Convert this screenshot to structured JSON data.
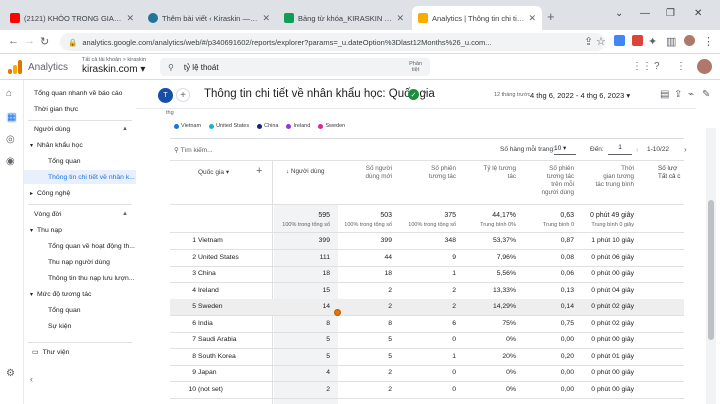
{
  "browser": {
    "tabs": [
      {
        "label": "(2121) KHÓO TRONG GIAO TIẾP...",
        "favicon_color": "#ff0000"
      },
      {
        "label": "Thêm bài viết ‹ Kiraskin — WordP...",
        "favicon_color": "#21759b"
      },
      {
        "label": "Bảng từ khóa_KIRASKIN - Google...",
        "favicon_color": "#0f9d58"
      },
      {
        "label": "Analytics | Thông tin chi tiết về n...",
        "favicon_color": "#f9ab00"
      }
    ],
    "new_tab": "+",
    "url": "analytics.google.com/analytics/web/#/p340691602/reports/explorer?params=_u.dateOption%3Dlast12Months%26_u.com..."
  },
  "ga_header": {
    "product": "Analytics",
    "account_path": "Tất cả tài khoản > kiraskin",
    "property": "kiraskin.com",
    "search_value": "tỷ lệ thoát",
    "search_hint": "Phân\ntiệt"
  },
  "sidebar": {
    "items": [
      {
        "label": "Tổng quan nhanh về báo cáo"
      },
      {
        "label": "Thời gian thực"
      },
      {
        "label": "Người dùng"
      },
      {
        "label": "Nhân khẩu học"
      },
      {
        "label": "Tổng quan"
      },
      {
        "label": "Thông tin chi tiết về nhân k..."
      },
      {
        "label": "Công nghệ"
      },
      {
        "label": "Vòng đời"
      },
      {
        "label": "Thu nạp"
      },
      {
        "label": "Tổng quan về hoạt động th..."
      },
      {
        "label": "Thu nạp người dùng"
      },
      {
        "label": "Thông tin thu nạp lưu lượn..."
      },
      {
        "label": "Mức độ tương tác"
      },
      {
        "label": "Tổng quan"
      },
      {
        "label": "Sự kiện"
      },
      {
        "label": "Thư viện"
      }
    ]
  },
  "report": {
    "avatar_letter": "T",
    "title": "Thông tin chi tiết về nhân khẩu học: Quốc gia",
    "date_label": "12 tháng trước",
    "date_range": "4 thg 6, 2022 - 4 thg 6, 2023",
    "stub": "thg",
    "legend": [
      {
        "name": "Vietnam",
        "color": "#1a73e8"
      },
      {
        "name": "United States",
        "color": "#12b5cb"
      },
      {
        "name": "China",
        "color": "#1a237e"
      },
      {
        "name": "Ireland",
        "color": "#9334e6"
      },
      {
        "name": "Sweden",
        "color": "#e52592"
      }
    ]
  },
  "table": {
    "search_placeholder": "Tìm kiếm...",
    "rows_per_page_label": "Số hàng mỗi trang:",
    "rows_per_page": "10",
    "goto_label": "Đến:",
    "goto_value": "1",
    "pager_text": "1-10/22",
    "dimension_header": "Quốc gia",
    "columns": [
      {
        "label": "↓ Người dùng"
      },
      {
        "label": "Số người\ndùng mới"
      },
      {
        "label": "Số phiên\ntương tác"
      },
      {
        "label": "Tỷ lệ tương\ntác"
      },
      {
        "label": "Số phiên\ntương tác\ntrên mỗi\nngười dùng"
      },
      {
        "label": "Thời\ngian tương\ntác trung bình"
      },
      {
        "label": "Số lượ\nTất cả c"
      }
    ],
    "totals": [
      {
        "value": "595",
        "sub": "100% trong tổng số"
      },
      {
        "value": "503",
        "sub": "100% trong tổng số"
      },
      {
        "value": "375",
        "sub": "100% trong tổng số"
      },
      {
        "value": "44,17%",
        "sub": "Trung bình 0%"
      },
      {
        "value": "0,63",
        "sub": "Trung bình 0"
      },
      {
        "value": "0 phút 49 giây",
        "sub": "Trung bình 0 giây"
      }
    ],
    "rows": [
      {
        "rank": "1",
        "country": "Vietnam",
        "users": "399",
        "new_users": "399",
        "sessions": "348",
        "rate": "53,37%",
        "per_user": "0,87",
        "time": "1 phút 10 giây"
      },
      {
        "rank": "2",
        "country": "United States",
        "users": "111",
        "new_users": "44",
        "sessions": "9",
        "rate": "7,96%",
        "per_user": "0,08",
        "time": "0 phút 06 giây"
      },
      {
        "rank": "3",
        "country": "China",
        "users": "18",
        "new_users": "18",
        "sessions": "1",
        "rate": "5,56%",
        "per_user": "0,06",
        "time": "0 phút 00 giây"
      },
      {
        "rank": "4",
        "country": "Ireland",
        "users": "15",
        "new_users": "2",
        "sessions": "2",
        "rate": "13,33%",
        "per_user": "0,13",
        "time": "0 phút 04 giây"
      },
      {
        "rank": "5",
        "country": "Sweden",
        "users": "14",
        "new_users": "2",
        "sessions": "2",
        "rate": "14,29%",
        "per_user": "0,14",
        "time": "0 phút 02 giây"
      },
      {
        "rank": "6",
        "country": "India",
        "users": "8",
        "new_users": "8",
        "sessions": "6",
        "rate": "75%",
        "per_user": "0,75",
        "time": "0 phút 02 giây"
      },
      {
        "rank": "7",
        "country": "Saudi Arabia",
        "users": "5",
        "new_users": "5",
        "sessions": "0",
        "rate": "0%",
        "per_user": "0,00",
        "time": "0 phút 00 giây"
      },
      {
        "rank": "8",
        "country": "South Korea",
        "users": "5",
        "new_users": "5",
        "sessions": "1",
        "rate": "20%",
        "per_user": "0,20",
        "time": "0 phút 01 giây"
      },
      {
        "rank": "9",
        "country": "Japan",
        "users": "4",
        "new_users": "2",
        "sessions": "0",
        "rate": "0%",
        "per_user": "0,00",
        "time": "0 phút 00 giây"
      },
      {
        "rank": "10",
        "country": "(not set)",
        "users": "2",
        "new_users": "2",
        "sessions": "0",
        "rate": "0%",
        "per_user": "0,00",
        "time": "0 phút 00 giây"
      }
    ]
  }
}
